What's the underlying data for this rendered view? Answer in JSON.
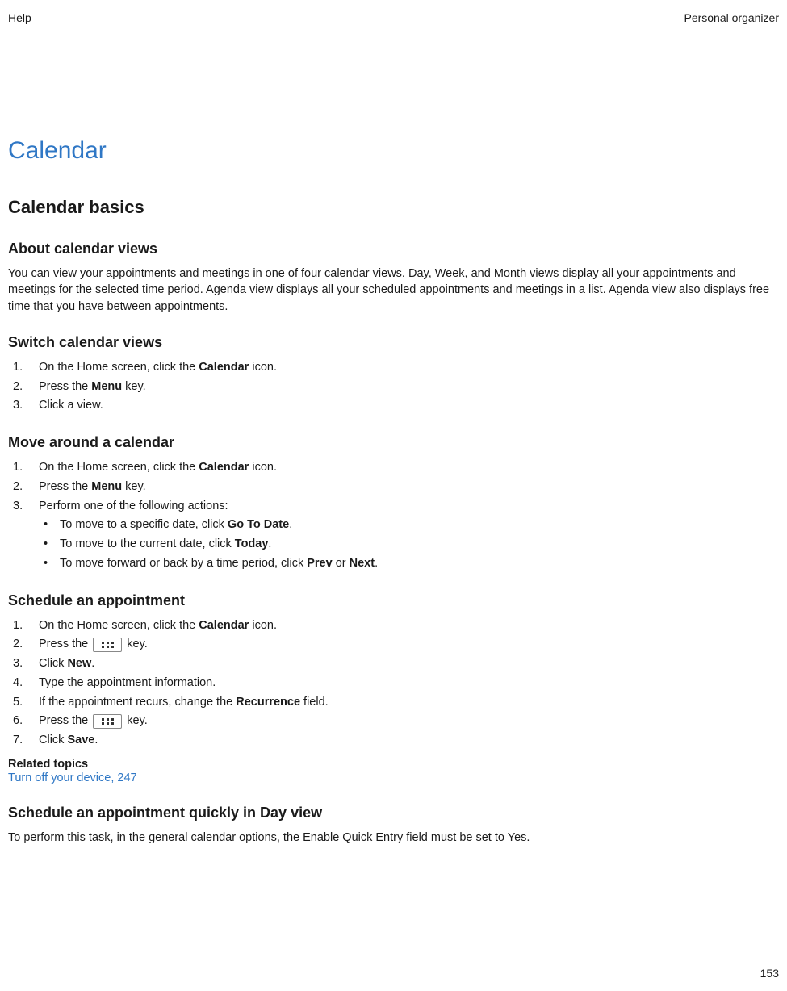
{
  "header": {
    "left": "Help",
    "right": "Personal organizer"
  },
  "main": {
    "title": "Calendar",
    "section1": {
      "title": "Calendar basics",
      "sub1": {
        "title": "About calendar views",
        "paragraph": "You can view your appointments and meetings in one of four calendar views. Day, Week, and Month views display all your appointments and meetings for the selected time period. Agenda view displays all your scheduled appointments and meetings in a list. Agenda view also displays free time that you have between appointments."
      },
      "sub2": {
        "title": "Switch calendar views",
        "li1a": "On the Home screen, click the ",
        "li1b": "Calendar",
        "li1c": " icon.",
        "li2a": "Press the ",
        "li2b": "Menu",
        "li2c": " key.",
        "li3": "Click a view."
      },
      "sub3": {
        "title": "Move around a calendar",
        "li1a": "On the Home screen, click the ",
        "li1b": "Calendar",
        "li1c": " icon.",
        "li2a": "Press the ",
        "li2b": "Menu",
        "li2c": " key.",
        "li3": "Perform one of the following actions:",
        "b1a": "To move to a specific date, click ",
        "b1b": "Go To Date",
        "b1c": ".",
        "b2a": "To move to the current date, click ",
        "b2b": "Today",
        "b2c": ".",
        "b3a": "To move forward or back by a time period, click ",
        "b3b": "Prev",
        "b3c": " or ",
        "b3d": "Next",
        "b3e": "."
      },
      "sub4": {
        "title": "Schedule an appointment",
        "li1a": "On the Home screen, click the ",
        "li1b": "Calendar",
        "li1c": " icon.",
        "li2a": "Press the ",
        "li2b": " key.",
        "li3a": "Click ",
        "li3b": "New",
        "li3c": ".",
        "li4": "Type the appointment information.",
        "li5a": "If the appointment recurs, change the ",
        "li5b": "Recurrence",
        "li5c": " field.",
        "li6a": "Press the ",
        "li6b": " key.",
        "li7a": "Click ",
        "li7b": "Save",
        "li7c": ".",
        "related": "Related topics",
        "link": "Turn off your device, 247"
      },
      "sub5": {
        "title": "Schedule an appointment quickly in Day view",
        "paragraph": "To perform this task, in the general calendar options, the Enable Quick Entry field must be set to Yes."
      }
    }
  },
  "footer": {
    "page": "153"
  }
}
